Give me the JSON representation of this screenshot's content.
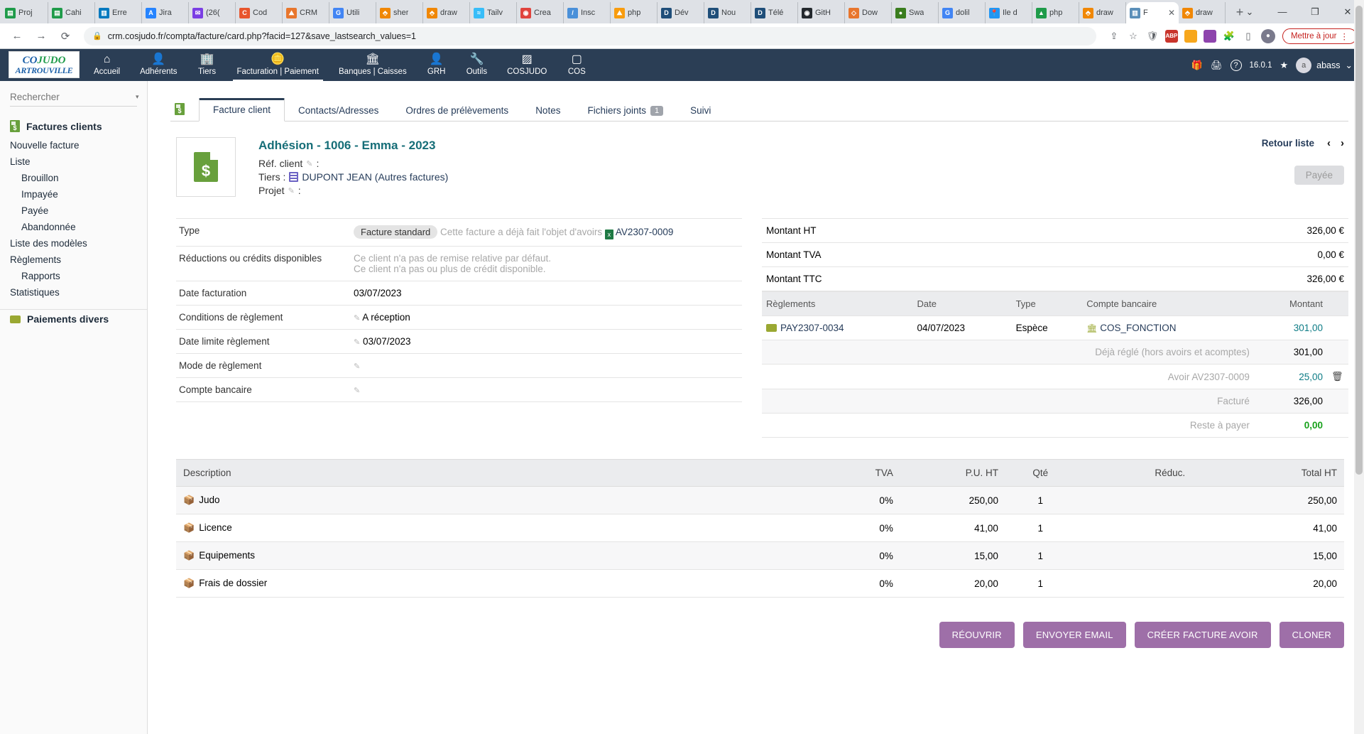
{
  "browser": {
    "tabs": [
      {
        "label": "Proj",
        "icon": "sheets-icon",
        "color": "#1f9b4a",
        "glyph": "▤"
      },
      {
        "label": "Cahi",
        "icon": "sheets-icon",
        "color": "#1f9b4a",
        "glyph": "▤"
      },
      {
        "label": "Erre",
        "icon": "trello-icon",
        "color": "#0079bf",
        "glyph": "▥"
      },
      {
        "label": "Jira",
        "icon": "jira-icon",
        "color": "#2684ff",
        "glyph": "A"
      },
      {
        "label": "(26(",
        "icon": "mail-icon",
        "color": "#7b3fe4",
        "glyph": "✉"
      },
      {
        "label": "Cod",
        "icon": "code-icon",
        "color": "#e8552d",
        "glyph": "C"
      },
      {
        "label": "CRM",
        "icon": "crm-icon",
        "color": "#e8762d",
        "glyph": "⛰"
      },
      {
        "label": "Utili",
        "icon": "google-icon",
        "color": "#4285f4",
        "glyph": "G"
      },
      {
        "label": "sher",
        "icon": "drawio-icon",
        "color": "#f08705",
        "glyph": "⬘"
      },
      {
        "label": "draw",
        "icon": "drawio-icon",
        "color": "#f08705",
        "glyph": "⬘"
      },
      {
        "label": "Tailv",
        "icon": "tailwind-icon",
        "color": "#38bdf8",
        "glyph": "≈"
      },
      {
        "label": "Crea",
        "icon": "crea-icon",
        "color": "#e0443e",
        "glyph": "◉"
      },
      {
        "label": "Insc",
        "icon": "pen-icon",
        "color": "#4a90d9",
        "glyph": "/"
      },
      {
        "label": "php",
        "icon": "phpmyadmin-icon",
        "color": "#f89c0e",
        "glyph": "⛰"
      },
      {
        "label": "Dév",
        "icon": "dolibarr-icon",
        "color": "#1f4e79",
        "glyph": "D"
      },
      {
        "label": "Nou",
        "icon": "dolibarr-icon",
        "color": "#1f4e79",
        "glyph": "D"
      },
      {
        "label": "Télé",
        "icon": "dolibarr-icon",
        "color": "#1f4e79",
        "glyph": "D"
      },
      {
        "label": "GitH",
        "icon": "github-icon",
        "color": "#24292e",
        "glyph": "◉"
      },
      {
        "label": "Dow",
        "icon": "diamond-icon",
        "color": "#e8762d",
        "glyph": "◇"
      },
      {
        "label": "Swa",
        "icon": "swagger-icon",
        "color": "#3a7d1e",
        "glyph": "●"
      },
      {
        "label": "dolil",
        "icon": "google-icon",
        "color": "#4285f4",
        "glyph": "G"
      },
      {
        "label": "Ile d",
        "icon": "maps-icon",
        "color": "#2196f3",
        "glyph": "📍"
      },
      {
        "label": "php",
        "icon": "drive-icon",
        "color": "#1f9b4a",
        "glyph": "▲"
      },
      {
        "label": "draw",
        "icon": "drawio-icon",
        "color": "#f08705",
        "glyph": "⬘"
      },
      {
        "label": "F",
        "icon": "dolibarr-icon",
        "color": "#5b8fb9",
        "glyph": "▥",
        "active": true
      },
      {
        "label": "draw",
        "icon": "drawio-icon",
        "color": "#f08705",
        "glyph": "⬘"
      }
    ],
    "newtab_label": "+",
    "tab_close_label": "✕",
    "window_controls": {
      "list": "⌄",
      "minimize": "—",
      "maximize": "❐",
      "close": "✕"
    },
    "nav": {
      "back": "←",
      "forward": "→",
      "reload": "⟳"
    },
    "url": "crm.cosjudo.fr/compta/facture/card.php?facid=127&save_lastsearch_values=1",
    "lock_icon": "🔒",
    "toolbar_icons": [
      "share-icon",
      "star-icon",
      "shield-icon",
      "abp-icon",
      "orange-ext-icon",
      "purple-ext-icon",
      "extensions-icon",
      "sidepanel-icon",
      "profile-avatar"
    ],
    "update_button": "Mettre à jour",
    "update_menu": "⋮"
  },
  "appnav": {
    "logo": {
      "line1_a": "CO",
      "line1_b": "JUDO",
      "line2": "ARTROUVILLE"
    },
    "items": [
      {
        "label": "Accueil",
        "icon": "home-icon",
        "glyph": "⌂",
        "active": false
      },
      {
        "label": "Adhérents",
        "icon": "user-icon",
        "glyph": "👤",
        "active": false
      },
      {
        "label": "Tiers",
        "icon": "building-icon",
        "glyph": "🏢",
        "active": false
      },
      {
        "label": "Facturation | Paiement",
        "icon": "coins-icon",
        "glyph": "🪙",
        "active": true
      },
      {
        "label": "Banques | Caisses",
        "icon": "bank-icon",
        "glyph": "🏛",
        "active": false
      },
      {
        "label": "GRH",
        "icon": "employee-icon",
        "glyph": "👤",
        "active": false
      },
      {
        "label": "Outils",
        "icon": "wrench-icon",
        "glyph": "🔧",
        "active": false
      },
      {
        "label": "COSJUDO",
        "icon": "chart-icon",
        "glyph": "▨",
        "active": false
      },
      {
        "label": "COS",
        "icon": "square-icon",
        "glyph": "▢",
        "active": false
      }
    ],
    "right": {
      "gift_icon": "🎁",
      "print_icon": "🖨",
      "help_icon": "?",
      "version": "16.0.1",
      "star_icon": "★",
      "user": "abass",
      "user_initial": "a",
      "user_caret": "⌄"
    }
  },
  "sidebar": {
    "search_placeholder": "Rechercher",
    "search_value": "",
    "caret": "▾",
    "section_title": "Factures clients",
    "items": [
      {
        "label": "Nouvelle facture",
        "level": 1
      },
      {
        "label": "Liste",
        "level": 1
      },
      {
        "label": "Brouillon",
        "level": 2
      },
      {
        "label": "Impayée",
        "level": 2
      },
      {
        "label": "Payée",
        "level": 2
      },
      {
        "label": "Abandonnée",
        "level": 2
      },
      {
        "label": "Liste des modèles",
        "level": 1
      },
      {
        "label": "Règlements",
        "level": 1
      },
      {
        "label": "Rapports",
        "level": 2
      },
      {
        "label": "Statistiques",
        "level": 1
      }
    ],
    "section2_title": "Paiements divers"
  },
  "tabs": [
    {
      "label": "Facture client",
      "active": true
    },
    {
      "label": "Contacts/Adresses",
      "active": false
    },
    {
      "label": "Ordres de prélèvements",
      "active": false
    },
    {
      "label": "Notes",
      "active": false
    },
    {
      "label": "Fichiers joints",
      "active": false,
      "badge": "1"
    },
    {
      "label": "Suivi",
      "active": false
    }
  ],
  "header": {
    "title": "Adhésion - 1006 - Emma - 2023",
    "ref_client_label": "Réf. client",
    "ref_client_value": "",
    "tiers_label": "Tiers :",
    "tiers_value": "DUPONT JEAN (Autres factures)",
    "projet_label": "Projet",
    "projet_value": "",
    "colon": ":",
    "retour_liste": "Retour liste",
    "prev_arrow": "‹",
    "next_arrow": "›",
    "status": "Payée"
  },
  "details": [
    {
      "key": "Type",
      "chip": "Facture standard",
      "note": "Cette facture a déjà fait l'objet d'avoirs",
      "link": "AV2307-0009"
    },
    {
      "key": "Réductions ou crédits disponibles",
      "lines": [
        "Ce client n'a pas de remise relative par défaut.",
        "Ce client n'a pas ou plus de crédit disponible."
      ]
    },
    {
      "key": "Date facturation",
      "value": "03/07/2023"
    },
    {
      "key": "Conditions de règlement",
      "value": "A réception",
      "editable": true
    },
    {
      "key": "Date limite règlement",
      "value": "03/07/2023",
      "editable": true
    },
    {
      "key": "Mode de règlement",
      "value": "",
      "editable": true
    },
    {
      "key": "Compte bancaire",
      "value": "",
      "editable": true
    }
  ],
  "amounts": [
    {
      "label": "Montant HT",
      "value": "326,00 €"
    },
    {
      "label": "Montant TVA",
      "value": "0,00 €"
    },
    {
      "label": "Montant TTC",
      "value": "326,00 €"
    }
  ],
  "payments": {
    "headers": [
      "Règlements",
      "Date",
      "Type",
      "Compte bancaire",
      "Montant"
    ],
    "rows": [
      {
        "ref": "PAY2307-0034",
        "date": "04/07/2023",
        "type": "Espèce",
        "account": "COS_FONCTION",
        "amount": "301,00"
      }
    ],
    "summary": [
      {
        "label": "Déjà réglé (hors avoirs et acomptes)",
        "value": "301,00",
        "style": "alt"
      },
      {
        "label": "Avoir AV2307-0009",
        "value": "25,00",
        "style": "link",
        "trash": true
      },
      {
        "label": "Facturé",
        "value": "326,00",
        "style": "alt"
      },
      {
        "label": "Reste à payer",
        "value": "0,00",
        "style": "green"
      }
    ]
  },
  "lines": {
    "headers": [
      "Description",
      "TVA",
      "P.U. HT",
      "Qté",
      "Réduc.",
      "Total HT"
    ],
    "rows": [
      {
        "description": "Judo",
        "tva": "0%",
        "pu": "250,00",
        "qte": "1",
        "reduc": "",
        "total": "250,00"
      },
      {
        "description": "Licence",
        "tva": "0%",
        "pu": "41,00",
        "qte": "1",
        "reduc": "",
        "total": "41,00"
      },
      {
        "description": "Equipements",
        "tva": "0%",
        "pu": "15,00",
        "qte": "1",
        "reduc": "",
        "total": "15,00"
      },
      {
        "description": "Frais de dossier",
        "tva": "0%",
        "pu": "20,00",
        "qte": "1",
        "reduc": "",
        "total": "20,00"
      }
    ]
  },
  "actions": [
    {
      "label": "RÉOUVRIR"
    },
    {
      "label": "ENVOYER EMAIL"
    },
    {
      "label": "CRÉER FACTURE AVOIR"
    },
    {
      "label": "CLONER"
    }
  ],
  "colors": {
    "navbar": "#2b3e55",
    "title": "#166e78",
    "button": "#9e6fa8",
    "green": "#18a11b"
  }
}
